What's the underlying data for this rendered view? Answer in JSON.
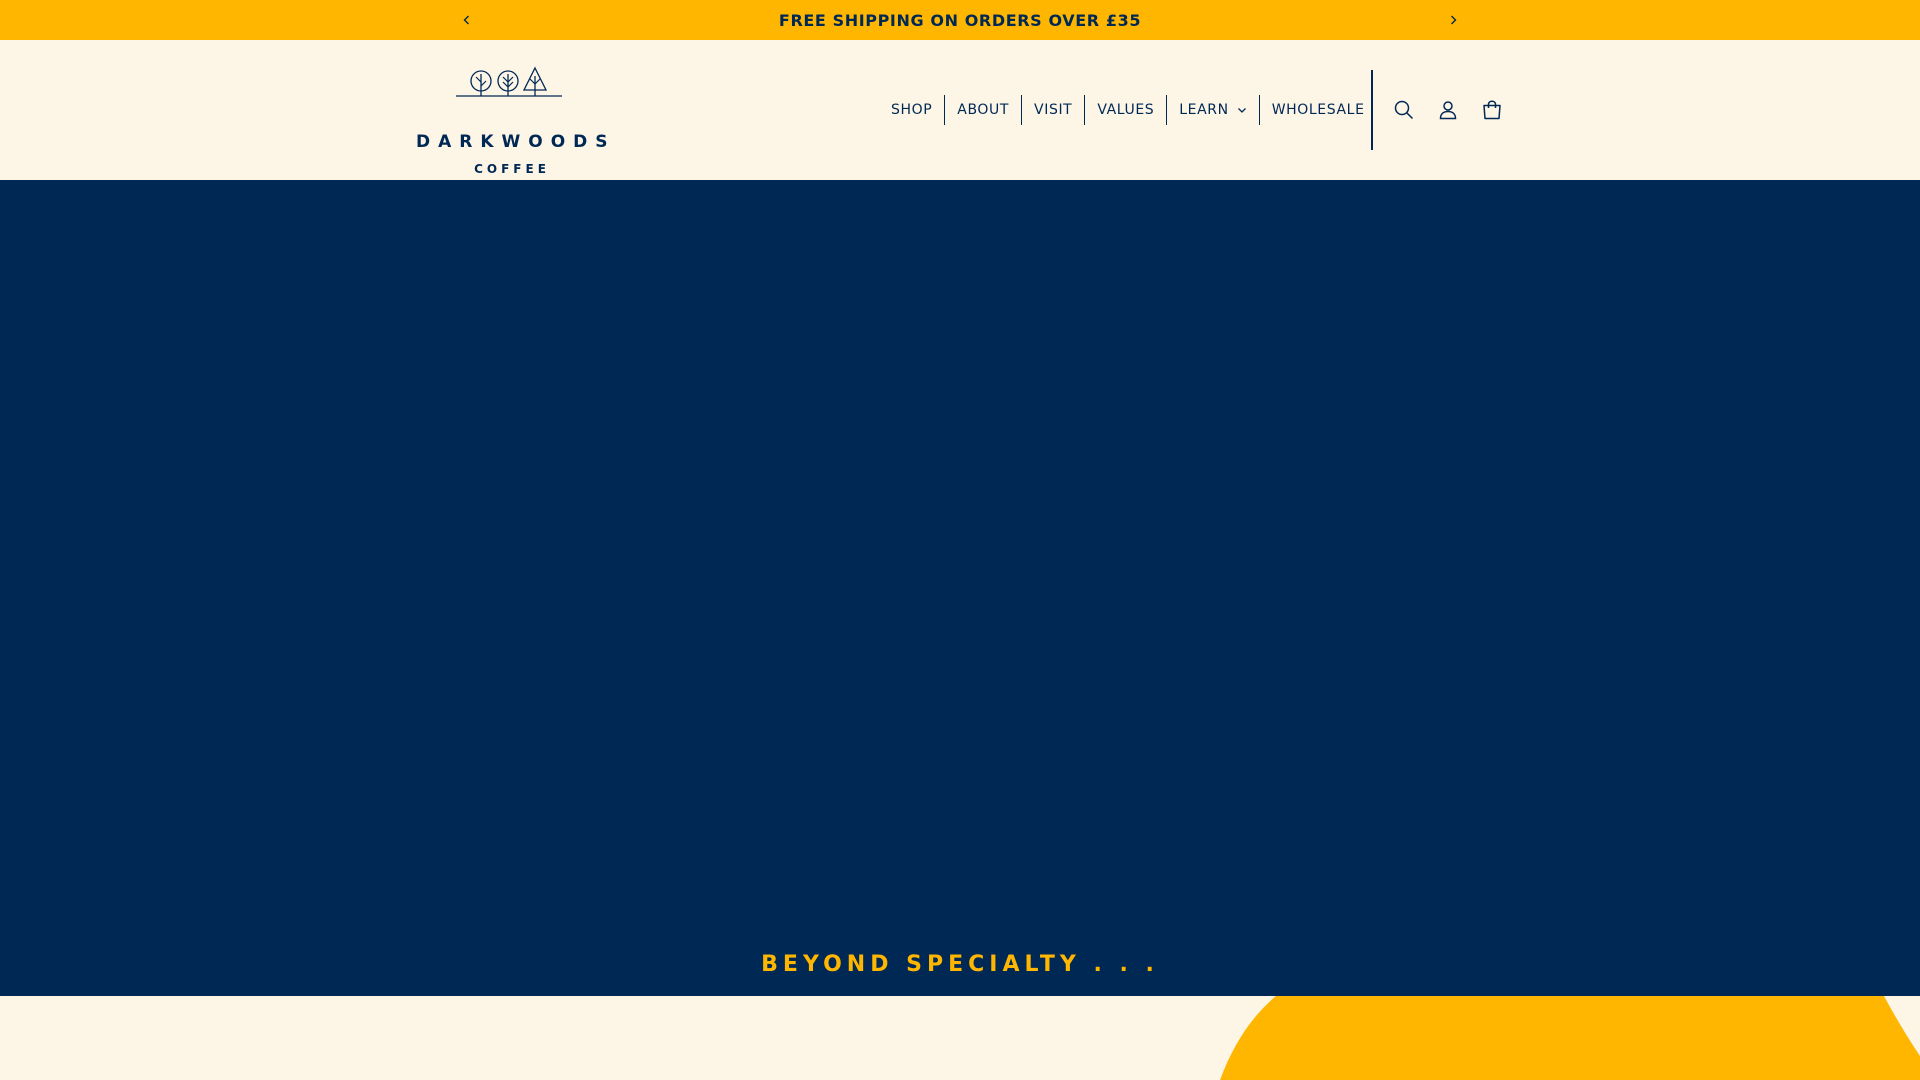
{
  "announcement": {
    "text": "FREE SHIPPING ON ORDERS OVER £35",
    "prev_icon": "chevron-left-icon",
    "next_icon": "chevron-right-icon"
  },
  "header": {
    "logo": {
      "wordmark": "DARKWOODS",
      "subtitle": "COFFEE"
    },
    "nav": [
      {
        "label": "SHOP"
      },
      {
        "label": "ABOUT"
      },
      {
        "label": "VISIT"
      },
      {
        "label": "VALUES"
      },
      {
        "label": "LEARN"
      },
      {
        "label": "WHOLESALE"
      }
    ],
    "icons": [
      "search-icon",
      "account-icon",
      "cart-icon"
    ]
  },
  "hero": {
    "tagline": "BEYOND SPECIALTY . . ."
  },
  "colors": {
    "navy": "#002855",
    "yellow": "#ffb600",
    "cream": "#fdf5e6"
  }
}
